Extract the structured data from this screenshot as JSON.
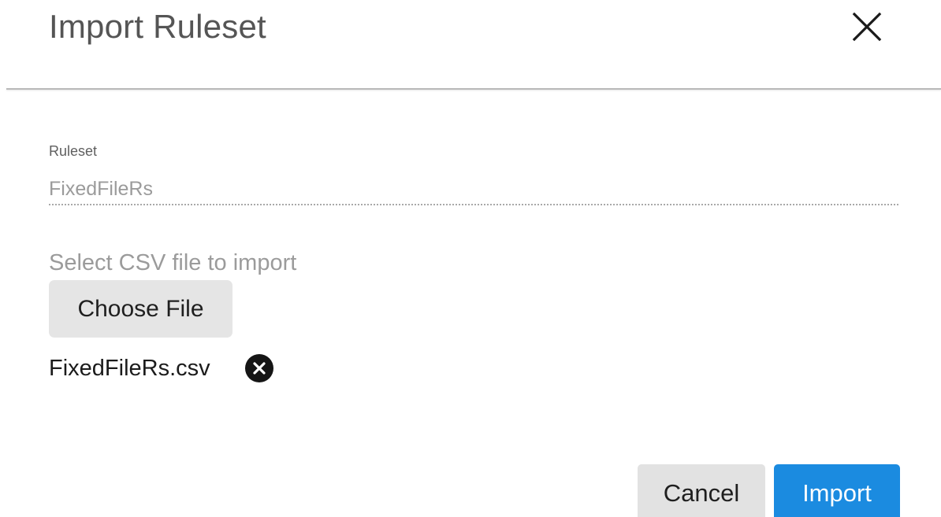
{
  "dialog": {
    "title": "Import Ruleset",
    "close_icon": "close-icon"
  },
  "ruleset_field": {
    "label": "Ruleset",
    "value": "FixedFileRs"
  },
  "file_picker": {
    "label": "Select CSV file to import",
    "button_label": "Choose File",
    "selected_file": "FixedFileRs.csv",
    "remove_icon": "remove-circle-icon"
  },
  "actions": {
    "cancel_label": "Cancel",
    "import_label": "Import"
  },
  "colors": {
    "primary": "#1b8be0",
    "secondary_button": "#e2e2e2",
    "title_text": "#555555",
    "muted_text": "#9b9b9b"
  }
}
